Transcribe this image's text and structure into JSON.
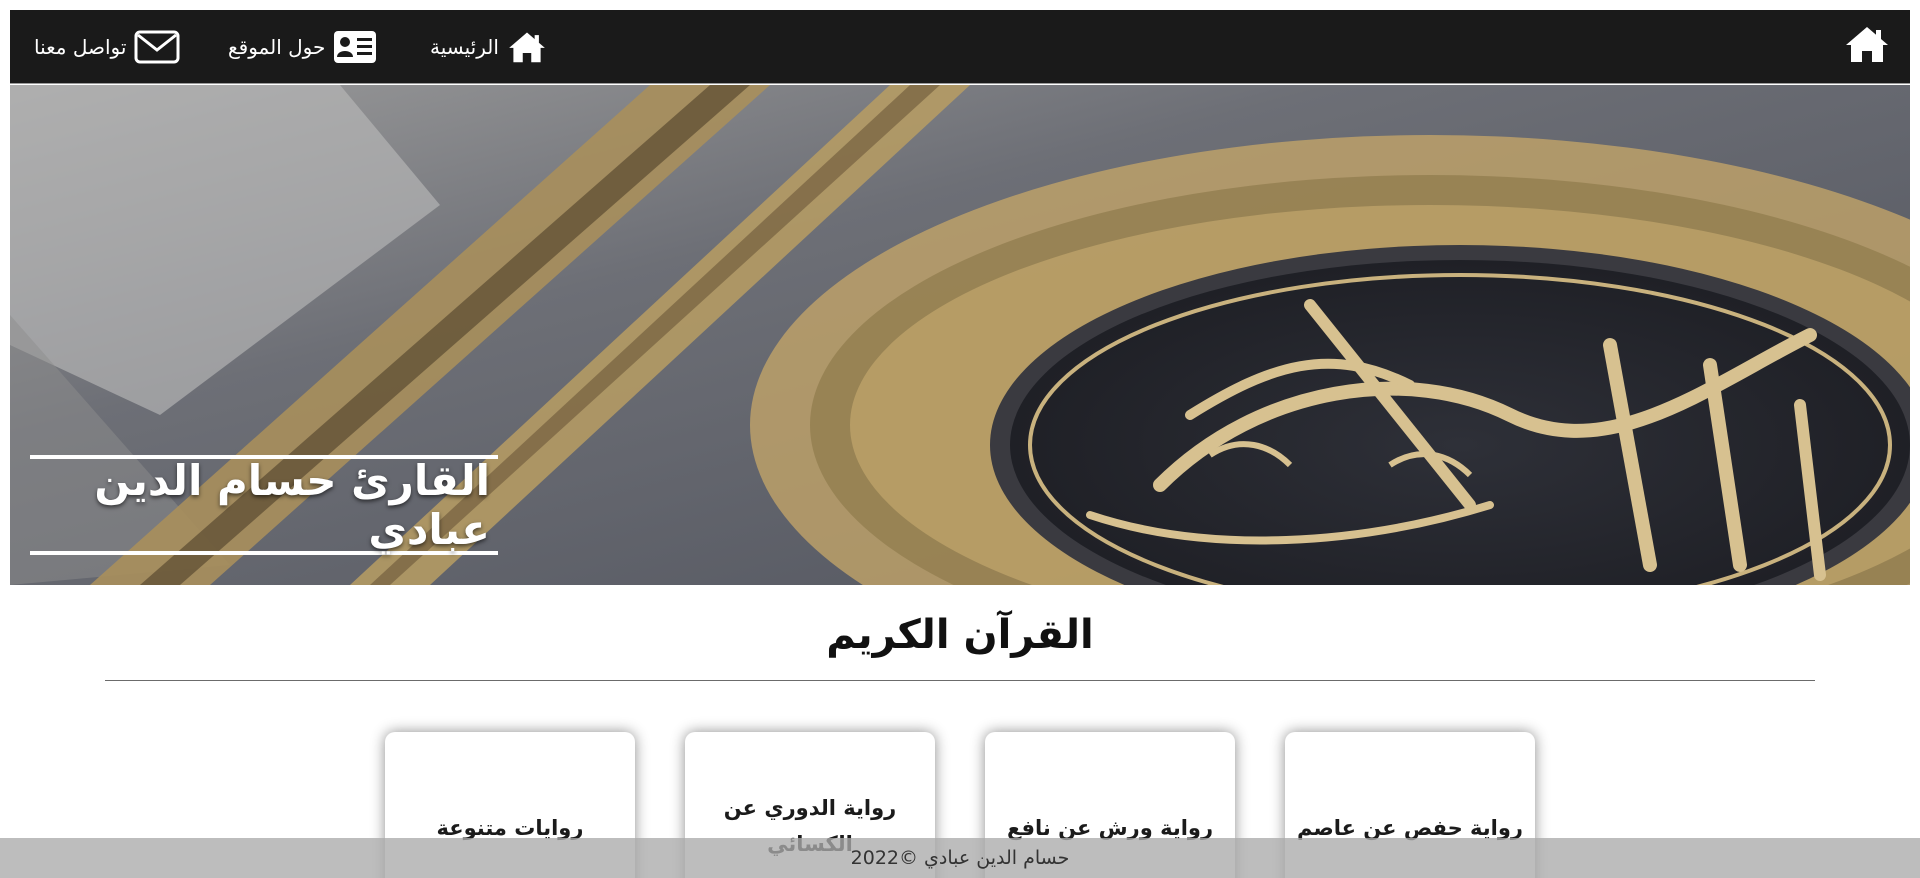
{
  "navbar": {
    "home_icon": "home-icon",
    "links": [
      {
        "label": "الرئيسية",
        "icon": "home-icon"
      },
      {
        "label": "حول الموقع",
        "icon": "id-card-icon"
      },
      {
        "label": "تواصل معنا",
        "icon": "envelope-icon"
      }
    ]
  },
  "hero": {
    "title": "القارئ حسام الدين عبادي"
  },
  "section": {
    "title": "القرآن الكريم"
  },
  "cards": [
    {
      "label": "رواية حفص عن عاصم"
    },
    {
      "label": "رواية ورش عن نافع"
    },
    {
      "label": "رواية الدوري عن الكسائي"
    },
    {
      "label": "روايات متنوعة"
    }
  ],
  "footer": {
    "text": "حسام الدين عبادي ©2022"
  },
  "colors": {
    "navbar_bg": "#1a1a1a",
    "footer_bg": "#aaaaaa",
    "text_dark": "#111111",
    "white": "#ffffff"
  }
}
